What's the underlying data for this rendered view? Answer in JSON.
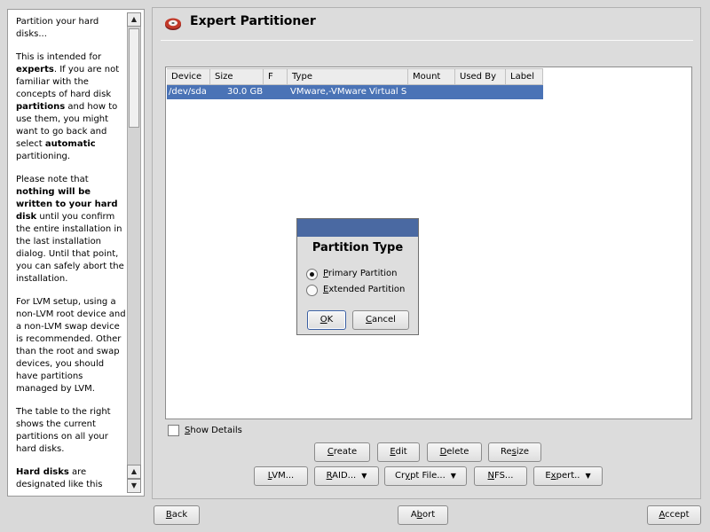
{
  "help": {
    "paragraphs": [
      [
        {
          "t": "Partition your hard disks..."
        }
      ],
      [
        {
          "t": "This is intended for "
        },
        {
          "t": "experts",
          "b": true
        },
        {
          "t": ". If you are not familiar with the concepts of hard disk "
        },
        {
          "t": "partitions",
          "b": true
        },
        {
          "t": " and how to use them, you might want to go back and select "
        },
        {
          "t": "automatic",
          "b": true
        },
        {
          "t": " partitioning."
        }
      ],
      [
        {
          "t": "Please note that "
        },
        {
          "t": "nothing will be written to your hard disk",
          "b": true
        },
        {
          "t": " until you confirm the entire installation in the last installation dialog. Until that point, you can safely abort the installation."
        }
      ],
      [
        {
          "t": "For LVM setup, using a non-LVM root device and a non-LVM swap device is recommended. Other than the root and swap devices, you should have partitions managed by LVM."
        }
      ],
      [
        {
          "t": "The table to the right shows the current partitions on all your hard disks."
        }
      ],
      [
        {
          "t": "Hard disks",
          "b": true
        },
        {
          "t": " are designated like this"
        }
      ]
    ]
  },
  "main": {
    "title": "Expert Partitioner",
    "table": {
      "columns": [
        "Device",
        "Size",
        "F",
        "Type",
        "Mount",
        "Used By",
        "Label"
      ],
      "rows": [
        {
          "device": "/dev/sda",
          "size": "30.0 GB",
          "f": "",
          "type": "VMware,-VMware Virtual S",
          "mount": "",
          "used_by": "",
          "label": ""
        }
      ]
    },
    "show_details": {
      "label": "Show Details",
      "mnemonic": "S",
      "checked": false
    },
    "buttons_row1": [
      {
        "label": "Create",
        "mnemonic": "C"
      },
      {
        "label": "Edit",
        "mnemonic": "E"
      },
      {
        "label": "Delete",
        "mnemonic": "D"
      },
      {
        "label": "Resize",
        "mnemonic": "s"
      }
    ],
    "buttons_row2": [
      {
        "label": "LVM...",
        "mnemonic": "L",
        "dropdown": false
      },
      {
        "label": "RAID...",
        "mnemonic": "R",
        "dropdown": true
      },
      {
        "label": "Crypt File...",
        "mnemonic": "y",
        "dropdown": true
      },
      {
        "label": "NFS...",
        "mnemonic": "N",
        "dropdown": false
      },
      {
        "label": "Expert..",
        "mnemonic": "x",
        "dropdown": true
      }
    ]
  },
  "dialog": {
    "title": "Partition Type",
    "options": [
      {
        "label": "Primary Partition",
        "mnemonic": "P",
        "selected": true
      },
      {
        "label": "Extended Partition",
        "mnemonic": "E",
        "selected": false
      }
    ],
    "ok": {
      "label": "OK",
      "mnemonic": "O"
    },
    "cancel": {
      "label": "Cancel",
      "mnemonic": "C"
    }
  },
  "footer": {
    "back": {
      "label": "Back",
      "mnemonic": "B"
    },
    "abort": {
      "label": "Abort",
      "mnemonic": "b"
    },
    "accept": {
      "label": "Accept",
      "mnemonic": "A"
    }
  },
  "colors": {
    "selection": "#4a73b6",
    "dialog_titlebar": "#4a69a2"
  },
  "icons": {
    "app": "yast-disk-icon",
    "dropdown": "triangle-down-icon",
    "scroll_up": "arrow-up-icon",
    "scroll_down": "arrow-down-icon"
  }
}
